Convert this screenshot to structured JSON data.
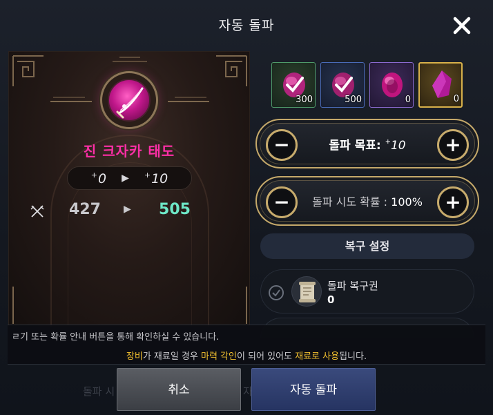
{
  "dialog": {
    "title": "자동 돌파"
  },
  "item": {
    "name": "진 크자카 태도",
    "level_from_prefix": "+",
    "level_from": "0",
    "level_to_prefix": "+",
    "level_to": "10",
    "stat_from": "427",
    "stat_to": "505",
    "name_color": "#ff2fa8"
  },
  "materials": [
    {
      "count": "300",
      "rarity": "green",
      "icon": "checked-gem-icon"
    },
    {
      "count": "500",
      "rarity": "blue",
      "icon": "checked-gem-icon"
    },
    {
      "count": "0",
      "rarity": "purple",
      "icon": "gem-icon"
    },
    {
      "count": "0",
      "rarity": "gold",
      "icon": "crystal-icon"
    }
  ],
  "goal": {
    "label": "돌파 목표: ",
    "prefix": "+",
    "value": "10"
  },
  "chance": {
    "label": "돌파 시도 확률 : ",
    "value": "100%"
  },
  "recovery": {
    "header": "복구 설정",
    "item_name": "돌파 복구권",
    "item_count": "0"
  },
  "notice": {
    "line1": "ㄹ기 또는 확률 안내 버튼을 통해 확인하실 수 있습니다.",
    "line2_a": "장비",
    "line2_b": "가 재료일 경우 ",
    "line2_c": "마력 각인",
    "line2_d": "이 되어 있어도 ",
    "line2_e": "재료로 사용",
    "line2_f": "됩니다."
  },
  "buttons": {
    "cancel": "취소",
    "auto": "자동 돌파"
  },
  "background_ghost": {
    "left": "돌파 시",
    "right": "자"
  },
  "colors": {
    "highlight": "#f2c02f",
    "stat_up": "#6ee8c8",
    "stepper_border": "#c5a96a"
  }
}
